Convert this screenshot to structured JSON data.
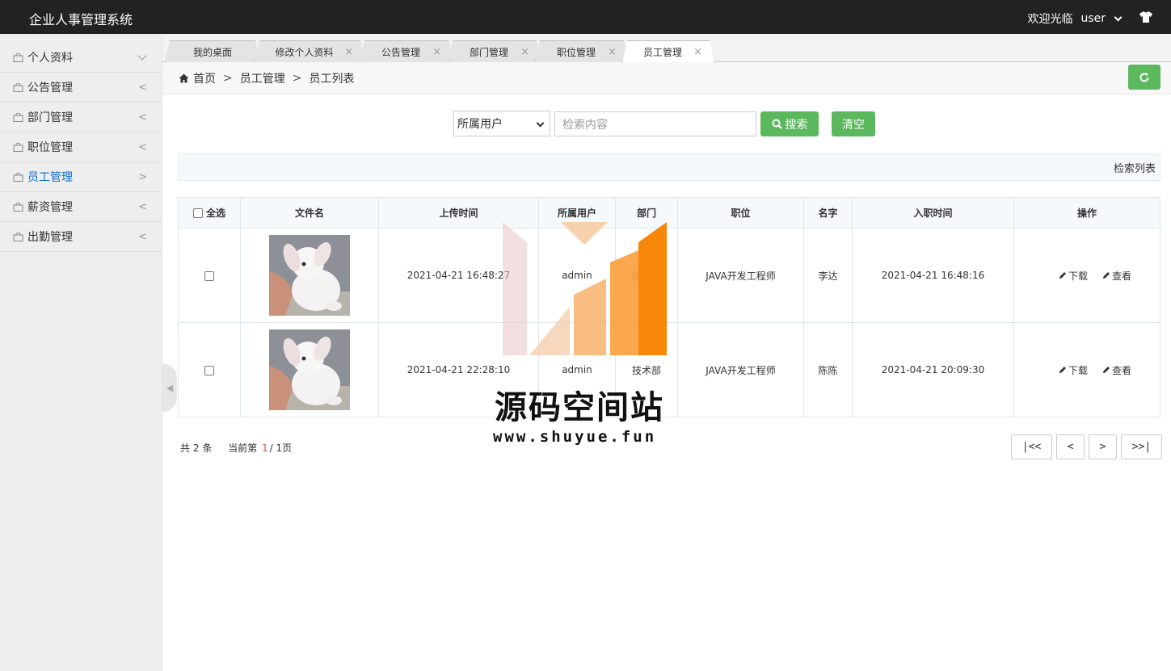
{
  "header": {
    "title": "企业人事管理系统",
    "welcome": "欢迎光临",
    "username": "user"
  },
  "sidebar": {
    "items": [
      {
        "label": "个人资料",
        "indicator": "chevron-down"
      },
      {
        "label": "公告管理",
        "indicator": "<"
      },
      {
        "label": "部门管理",
        "indicator": "<"
      },
      {
        "label": "职位管理",
        "indicator": "<"
      },
      {
        "label": "员工管理",
        "indicator": ">",
        "active": true
      },
      {
        "label": "薪资管理",
        "indicator": "<"
      },
      {
        "label": "出勤管理",
        "indicator": "<"
      }
    ]
  },
  "tabs": [
    {
      "label": "我的桌面",
      "closable": false
    },
    {
      "label": "修改个人资料",
      "closable": true
    },
    {
      "label": "公告管理",
      "closable": true
    },
    {
      "label": "部门管理",
      "closable": true
    },
    {
      "label": "职位管理",
      "closable": true
    },
    {
      "label": "员工管理",
      "closable": true,
      "active": true
    }
  ],
  "tab_close_glyph": "×",
  "breadcrumb": {
    "items": [
      "首页",
      "员工管理",
      "员工列表"
    ],
    "separator": ">"
  },
  "search": {
    "select_value": "所属用户",
    "placeholder": "检索内容",
    "search_label": "搜索",
    "clear_label": "清空"
  },
  "panel": {
    "title": "检索列表"
  },
  "table": {
    "select_all_label": "全选",
    "columns": [
      "文件名",
      "上传时间",
      "所属用户",
      "部门",
      "职位",
      "名字",
      "入职时间",
      "操作"
    ],
    "rows": [
      {
        "upload_time": "2021-04-21 16:48:27",
        "user": "admin",
        "dept": "技术部",
        "position": "JAVA开发工程师",
        "name": "李达",
        "hire_time": "2021-04-21 16:48:16"
      },
      {
        "upload_time": "2021-04-21 22:28:10",
        "user": "admin",
        "dept": "技术部",
        "position": "JAVA开发工程师",
        "name": "陈陈",
        "hire_time": "2021-04-21 20:09:30"
      }
    ],
    "op_download": "下载",
    "op_view": "查看"
  },
  "pager": {
    "total_prefix": "共",
    "total": "2",
    "total_suffix": "条",
    "current_prefix": "当前第",
    "current": "1",
    "pages_sep": "/",
    "pages": "1",
    "pages_suffix": "页",
    "first": "|<<",
    "prev": "<",
    "next": ">",
    "last": ">>|"
  },
  "watermark": {
    "text": "源码空间站",
    "url": "www.shuyue.fun"
  },
  "colors": {
    "header_bg": "#222222",
    "accent_green": "#5cb85c",
    "active_link": "#0d6ad0",
    "page_current": "#d9534f"
  }
}
